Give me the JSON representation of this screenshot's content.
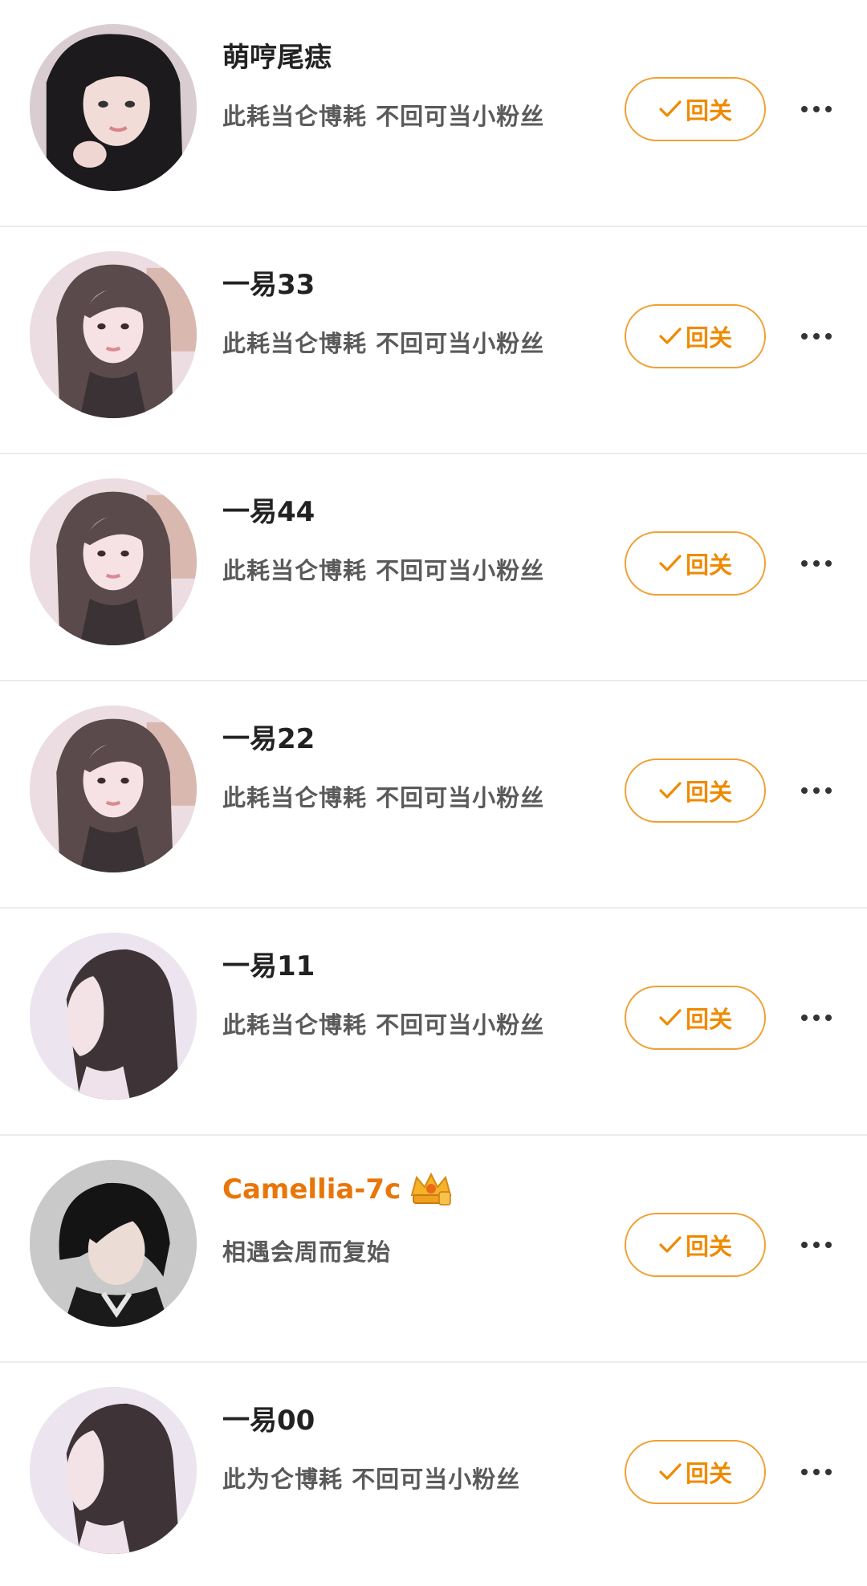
{
  "accent_color": "#ef8a00",
  "vip_name_color": "#e8760a",
  "fans": [
    {
      "name": "萌哼尾痣",
      "desc": "此耗当仑博耗  不回可当小粉丝",
      "avatar": "dark-hair-girl-avatar",
      "vip": false,
      "button_label": "回关"
    },
    {
      "name": "一易33",
      "desc": "此耗当仑博耗  不回可当小粉丝",
      "avatar": "pink-room-girl-avatar",
      "vip": false,
      "button_label": "回关"
    },
    {
      "name": "一易44",
      "desc": "此耗当仑博耗  不回可当小粉丝",
      "avatar": "pink-room-girl-avatar",
      "vip": false,
      "button_label": "回关"
    },
    {
      "name": "一易22",
      "desc": "此耗当仑博耗  不回可当小粉丝",
      "avatar": "pink-room-girl-avatar",
      "vip": false,
      "button_label": "回关"
    },
    {
      "name": "一易11",
      "desc": "此耗当仑博耗  不回可当小粉丝",
      "avatar": "profile-girl-avatar",
      "vip": false,
      "button_label": "回关"
    },
    {
      "name": "Camellia-7c",
      "desc": "相遇会周而复始",
      "avatar": "dark-hair-boy-avatar",
      "vip": true,
      "badge_icon": "crown-badge-icon",
      "button_label": "回关"
    },
    {
      "name": "一易00",
      "desc": "此为仑博耗  不回可当小粉丝",
      "avatar": "profile-girl-avatar",
      "vip": false,
      "button_label": "回关"
    }
  ]
}
